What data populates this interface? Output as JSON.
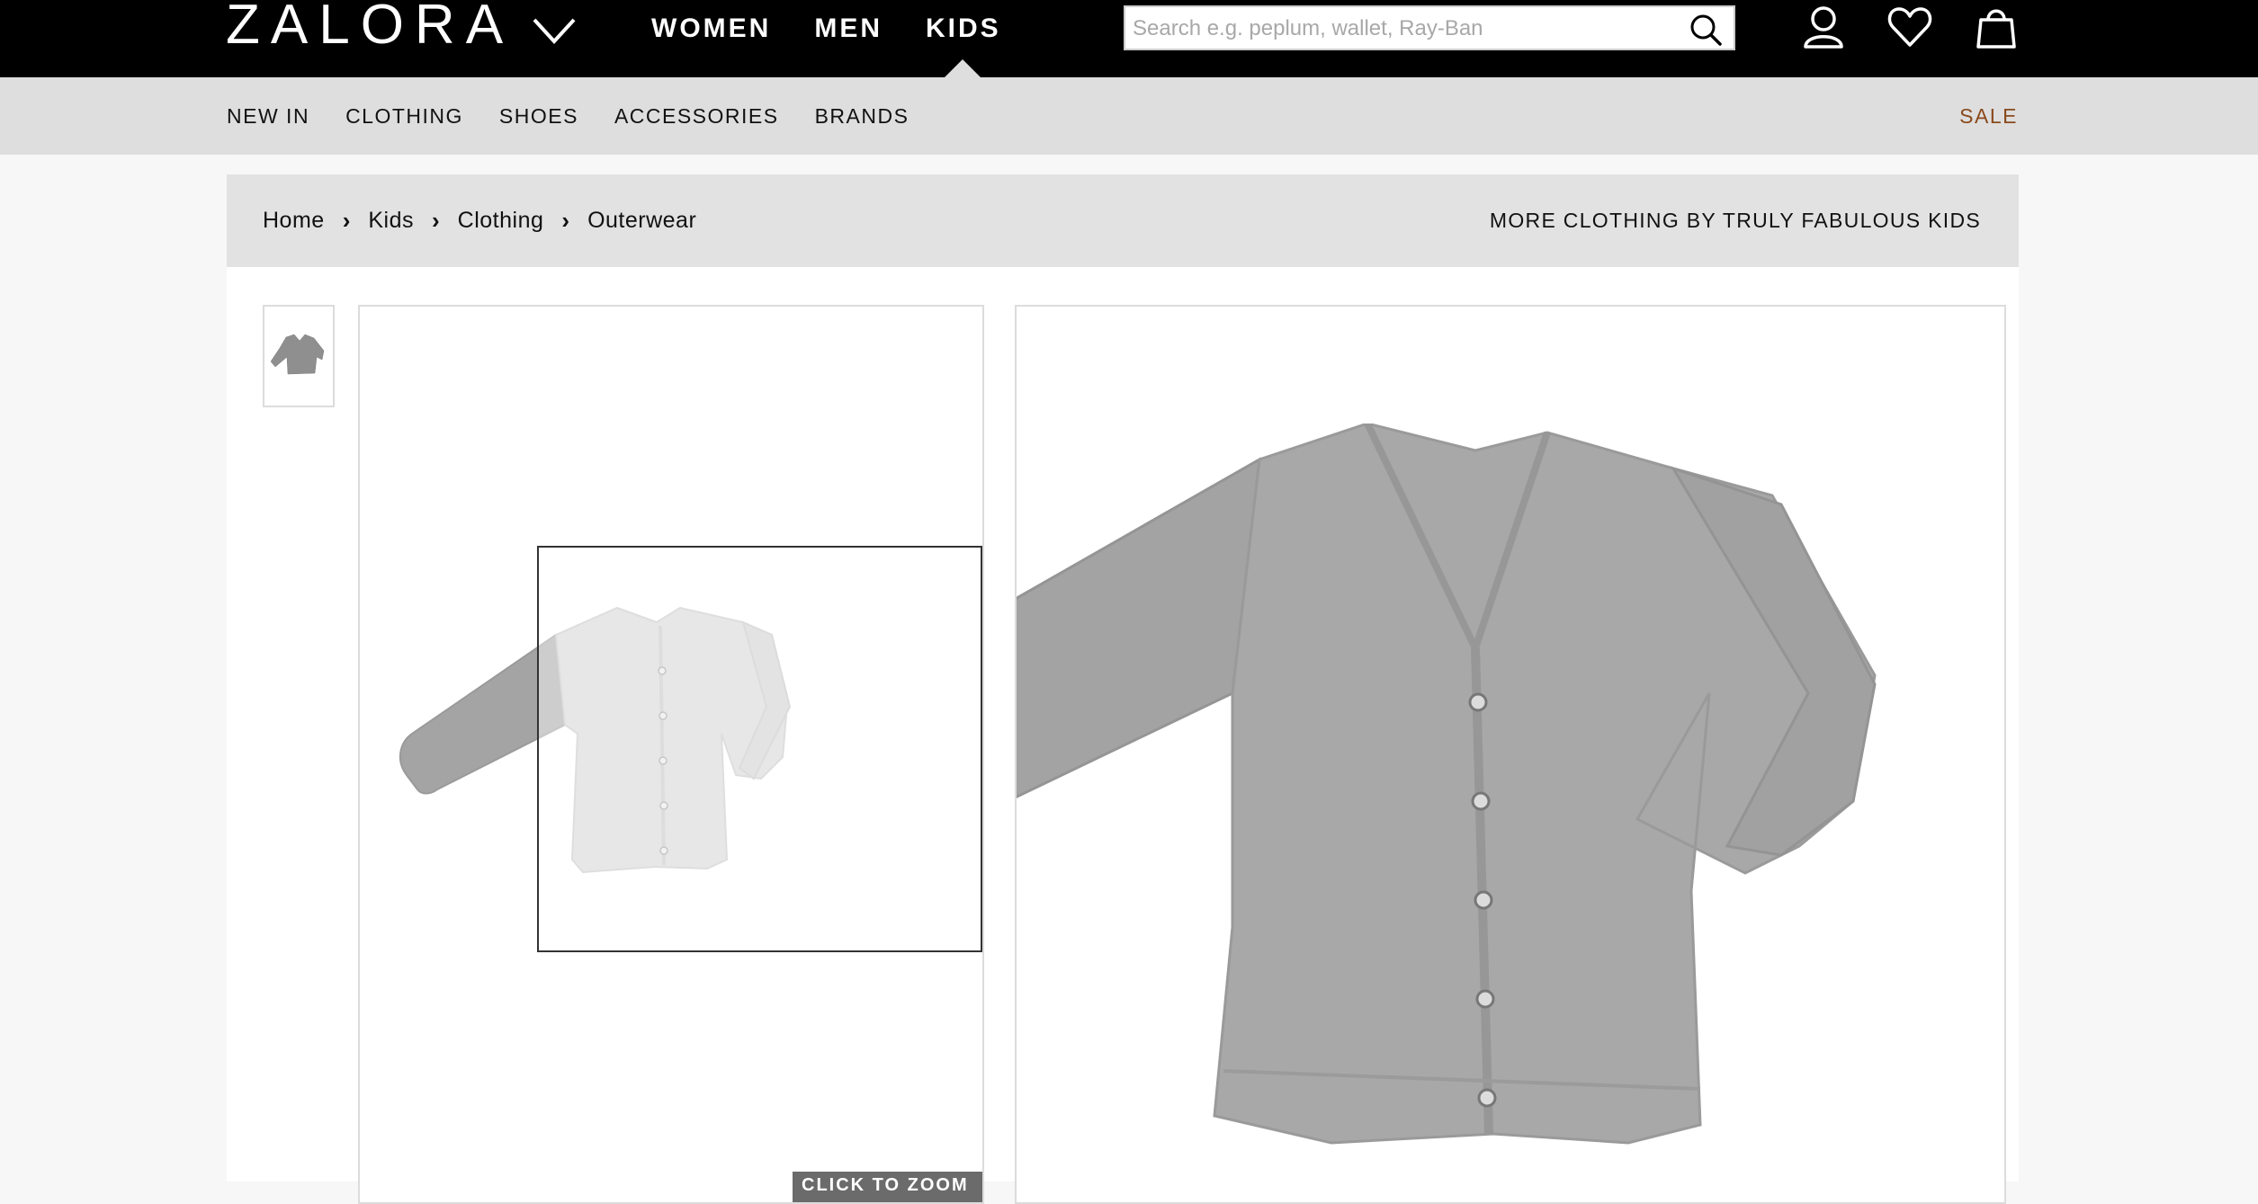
{
  "header": {
    "logo": "ZALORA",
    "nav": [
      "WOMEN",
      "MEN",
      "KIDS"
    ],
    "active_nav": "KIDS",
    "search": {
      "placeholder": "Search e.g. peplum, wallet, Ray-Ban",
      "value": ""
    },
    "icons": [
      "search-icon",
      "account-icon",
      "wishlist-heart-icon",
      "shopping-bag-icon"
    ]
  },
  "category_bar": {
    "items": [
      "NEW IN",
      "CLOTHING",
      "SHOES",
      "ACCESSORIES",
      "BRANDS"
    ],
    "sale": "SALE"
  },
  "breadcrumb": {
    "items": [
      "Home",
      "Kids",
      "Clothing",
      "Outerwear"
    ],
    "separator": "›",
    "more_by": "MORE CLOTHING BY TRULY FABULOUS KIDS"
  },
  "gallery": {
    "click_to_zoom": "CLICK TO ZOOM"
  },
  "colors": {
    "topbar": "#000000",
    "category_bar": "#dedede",
    "sale": "#8a4a1c",
    "product": "#a5a5a5"
  }
}
